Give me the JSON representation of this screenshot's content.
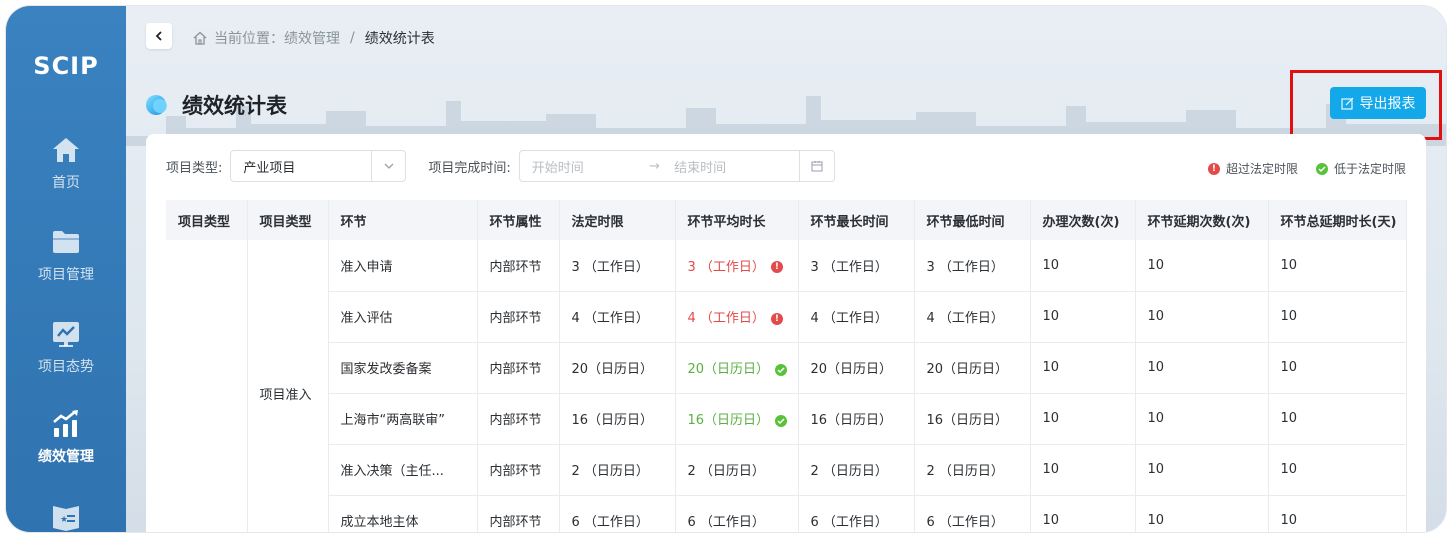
{
  "app": {
    "logo": "SCIP"
  },
  "sidebar": {
    "items": [
      {
        "label": "首页",
        "icon": "home-icon"
      },
      {
        "label": "项目管理",
        "icon": "folder-icon"
      },
      {
        "label": "项目态势",
        "icon": "trend-board-icon"
      },
      {
        "label": "绩效管理",
        "icon": "performance-chart-icon",
        "active": true
      },
      {
        "label": "",
        "icon": "book-icon"
      }
    ]
  },
  "breadcrumb": {
    "prefix": "当前位置：",
    "parent": "绩效管理",
    "separator": "/",
    "current": "绩效统计表"
  },
  "page": {
    "title": "绩效统计表",
    "export_label": "导出报表"
  },
  "filters": {
    "project_type_label": "项目类型:",
    "project_type_value": "产业项目",
    "completion_time_label": "项目完成时间:",
    "start_placeholder": "开始时间",
    "end_placeholder": "结束时间"
  },
  "legend": {
    "over": "超过法定时限",
    "under": "低于法定时限",
    "over_color": "#e44a4a",
    "under_color": "#58c23a"
  },
  "table": {
    "headers": [
      "项目类型",
      "项目类型",
      "环节",
      "环节属性",
      "法定时限",
      "环节平均时长",
      "环节最长时间",
      "环节最低时间",
      "办理次数(次)",
      "环节延期次数(次)",
      "环节总延期时长(天)"
    ],
    "group_label": "项目准入",
    "rows": [
      {
        "step": "准入申请",
        "attr": "内部环节",
        "legal": "3 （工作日）",
        "avg": "3 （工作日）",
        "avg_status": "over",
        "max": "3 （工作日）",
        "min": "3 （工作日）",
        "count": "10",
        "delay_count": "10",
        "delay_days": "10"
      },
      {
        "step": "准入评估",
        "attr": "内部环节",
        "legal": "4 （工作日）",
        "avg": "4 （工作日）",
        "avg_status": "over",
        "max": "4 （工作日）",
        "min": "4 （工作日）",
        "count": "10",
        "delay_count": "10",
        "delay_days": "10"
      },
      {
        "step": "国家发改委备案",
        "attr": "内部环节",
        "legal": "20（日历日）",
        "avg": "20（日历日）",
        "avg_status": "under",
        "max": "20（日历日）",
        "min": "20（日历日）",
        "count": "10",
        "delay_count": "10",
        "delay_days": "10"
      },
      {
        "step": "上海市“两高联审”",
        "attr": "内部环节",
        "legal": "16（日历日）",
        "avg": "16（日历日）",
        "avg_status": "under",
        "max": "16（日历日）",
        "min": "16（日历日）",
        "count": "10",
        "delay_count": "10",
        "delay_days": "10"
      },
      {
        "step": "准入决策（主任...",
        "attr": "内部环节",
        "legal": "2 （日历日）",
        "avg": "2 （日历日）",
        "avg_status": "normal",
        "max": "2 （日历日）",
        "min": "2 （日历日）",
        "count": "10",
        "delay_count": "10",
        "delay_days": "10"
      },
      {
        "step": "成立本地主体",
        "attr": "内部环节",
        "legal": "6 （工作日）",
        "avg": "6 （工作日）",
        "avg_status": "normal",
        "max": "6 （工作日）",
        "min": "6 （工作日）",
        "count": "10",
        "delay_count": "10",
        "delay_days": "10"
      }
    ]
  }
}
